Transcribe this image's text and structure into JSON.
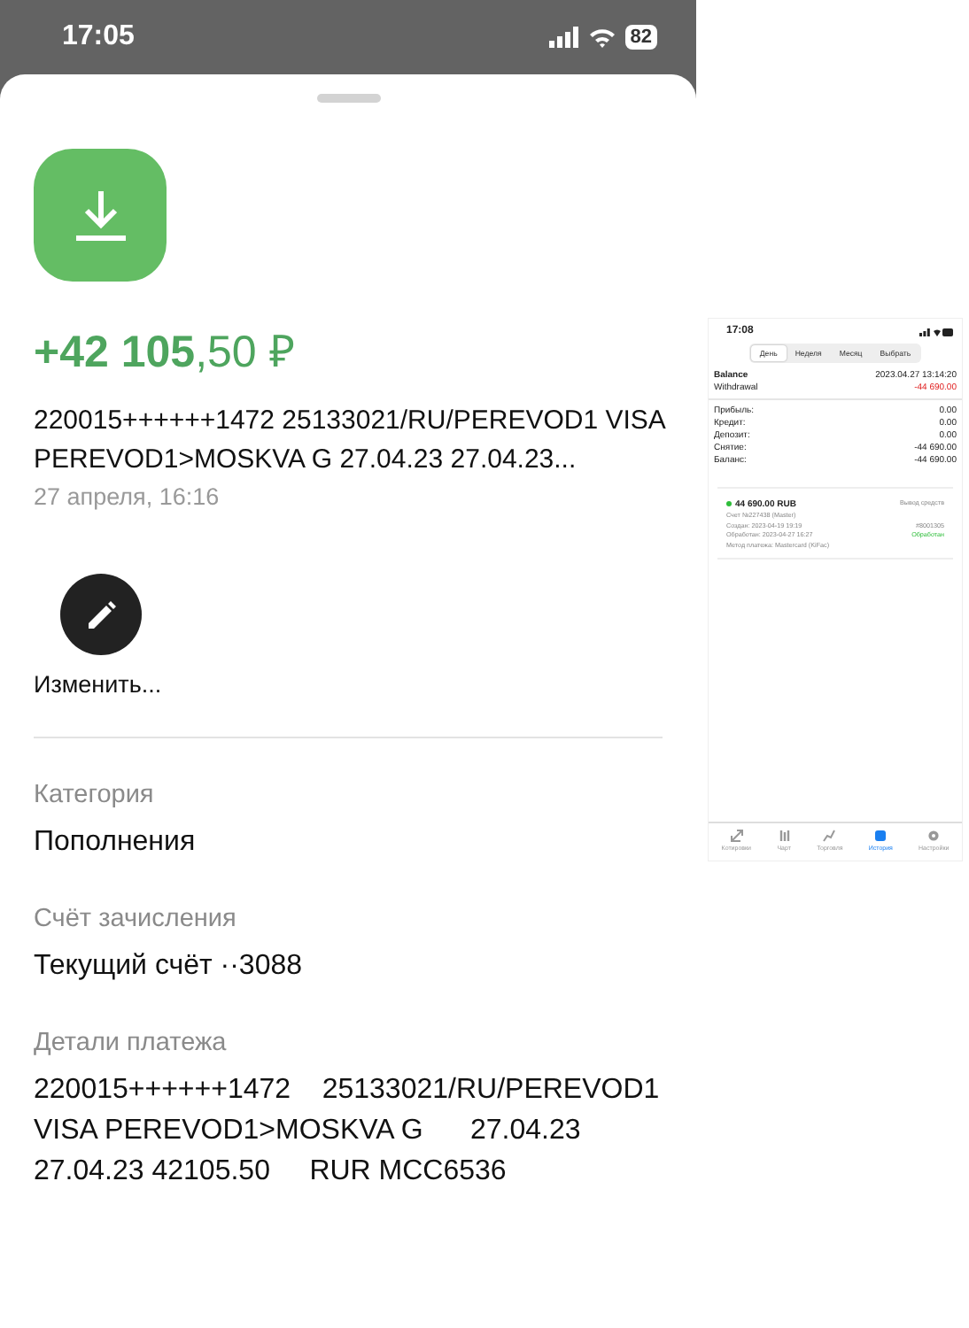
{
  "status_bar": {
    "time": "17:05",
    "battery": "82"
  },
  "operation": {
    "amount_whole": "+42 105",
    "amount_fraction": ",50 ₽",
    "description": "220015++++++1472 25133021/RU/PEREVOD1 VISA PEREVOD1>MOSKVA G 27.04.23 27.04.23...",
    "date": "27 апреля, 16:16"
  },
  "actions": [
    {
      "label": "Изменить..."
    }
  ],
  "fields": [
    {
      "label": "Категория",
      "value": "Пополнения"
    },
    {
      "label": "Счёт зачисления",
      "value": "Текущий счёт ··3088"
    },
    {
      "label": "Детали платежа",
      "value": "220015++++++1472    25133021/RU/PEREVOD1 VISA PEREVOD1>MOSKVA G      27.04.23 27.04.23 42105.50     RUR MCC6536"
    }
  ],
  "inset_screenshot": {
    "status_time": "17:08",
    "tabs": [
      {
        "label": "День",
        "selected": true
      },
      {
        "label": "Неделя",
        "selected": false
      },
      {
        "label": "Месяц",
        "selected": false
      },
      {
        "label": "Выбрать",
        "selected": false
      }
    ],
    "balance": {
      "title": "Balance",
      "timestamp": "2023.04.27 13:14:20",
      "type": "Withdrawal",
      "amount": "-44 690.00"
    },
    "summary": [
      {
        "label": "Прибыль:",
        "value": "0.00"
      },
      {
        "label": "Кредит:",
        "value": "0.00"
      },
      {
        "label": "Депозит:",
        "value": "0.00"
      },
      {
        "label": "Снятие:",
        "value": "-44 690.00"
      },
      {
        "label": "Баланс:",
        "value": "-44 690.00"
      }
    ],
    "request": {
      "amount": "44 690.00 RUB",
      "account": "Счет №227438 (Master)",
      "type": "Вывод средств",
      "created": "Создан: 2023-04-19 19:19",
      "processed": "Обработан: 2023-04-27 16:27",
      "method": "Метод платежа: Mastercard (KiFac)",
      "number": "#8001305",
      "status": "Обработан",
      "color": "#2ebd3a"
    },
    "nav": [
      {
        "label": "Котировки",
        "selected": false
      },
      {
        "label": "Чарт",
        "selected": false
      },
      {
        "label": "Торговля",
        "selected": false
      },
      {
        "label": "История",
        "selected": true
      },
      {
        "label": "Настройки",
        "selected": false
      }
    ]
  }
}
